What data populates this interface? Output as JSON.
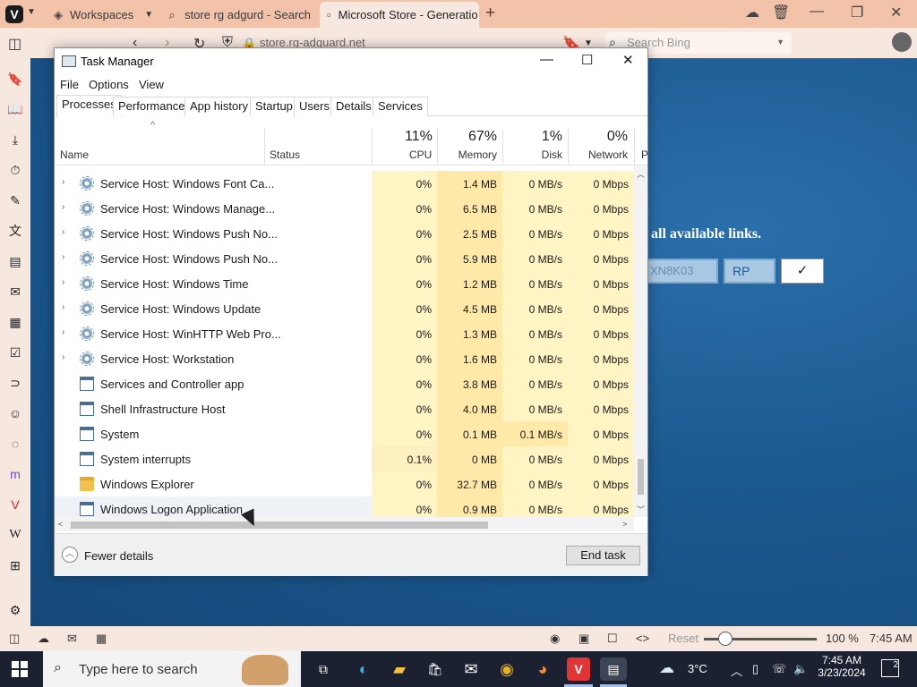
{
  "browser": {
    "workspaces_label": "Workspaces",
    "tabs": [
      {
        "label": "store rg adgurd - Search",
        "icon": "search-icon"
      },
      {
        "label": "Microsoft Store - Generatio",
        "icon": "store-favicon"
      }
    ],
    "url": "store.rg-adguard.net",
    "search_placeholder": "Search Bing",
    "status": {
      "reset_label": "Reset",
      "zoom": "100 %",
      "time": "7:45 AM"
    }
  },
  "webpage": {
    "links_text": "all available links.",
    "input_value": "XN8K03",
    "select_value": "RP",
    "submit_label": "✓"
  },
  "task_manager": {
    "title": "Task Manager",
    "menu": [
      "File",
      "Options",
      "View"
    ],
    "tabs": [
      "Processes",
      "Performance",
      "App history",
      "Startup",
      "Users",
      "Details",
      "Services"
    ],
    "active_tab": "Processes",
    "columns": {
      "name": "Name",
      "status": "Status",
      "cpu": {
        "pct": "11%",
        "label": "CPU"
      },
      "memory": {
        "pct": "67%",
        "label": "Memory"
      },
      "disk": {
        "pct": "1%",
        "label": "Disk"
      },
      "network": {
        "pct": "0%",
        "label": "Network"
      },
      "cut": "P"
    },
    "rows": [
      {
        "name": "Service Host: Windows Font Ca...",
        "icon": "gear-icon",
        "expandable": true,
        "cpu": "0%",
        "memory": "1.4 MB",
        "disk": "0 MB/s",
        "network": "0 Mbps"
      },
      {
        "name": "Service Host: Windows Manage...",
        "icon": "gear-icon",
        "expandable": true,
        "cpu": "0%",
        "memory": "6.5 MB",
        "disk": "0 MB/s",
        "network": "0 Mbps"
      },
      {
        "name": "Service Host: Windows Push No...",
        "icon": "gear-icon",
        "expandable": true,
        "cpu": "0%",
        "memory": "2.5 MB",
        "disk": "0 MB/s",
        "network": "0 Mbps"
      },
      {
        "name": "Service Host: Windows Push No...",
        "icon": "gear-icon",
        "expandable": true,
        "cpu": "0%",
        "memory": "5.9 MB",
        "disk": "0 MB/s",
        "network": "0 Mbps"
      },
      {
        "name": "Service Host: Windows Time",
        "icon": "gear-icon",
        "expandable": true,
        "cpu": "0%",
        "memory": "1.2 MB",
        "disk": "0 MB/s",
        "network": "0 Mbps"
      },
      {
        "name": "Service Host: Windows Update",
        "icon": "gear-icon",
        "expandable": true,
        "cpu": "0%",
        "memory": "4.5 MB",
        "disk": "0 MB/s",
        "network": "0 Mbps"
      },
      {
        "name": "Service Host: WinHTTP Web Pro...",
        "icon": "gear-icon",
        "expandable": true,
        "cpu": "0%",
        "memory": "1.3 MB",
        "disk": "0 MB/s",
        "network": "0 Mbps"
      },
      {
        "name": "Service Host: Workstation",
        "icon": "gear-icon",
        "expandable": true,
        "cpu": "0%",
        "memory": "1.6 MB",
        "disk": "0 MB/s",
        "network": "0 Mbps"
      },
      {
        "name": "Services and Controller app",
        "icon": "window-icon",
        "expandable": false,
        "cpu": "0%",
        "memory": "3.8 MB",
        "disk": "0 MB/s",
        "network": "0 Mbps"
      },
      {
        "name": "Shell Infrastructure Host",
        "icon": "window-icon",
        "expandable": false,
        "cpu": "0%",
        "memory": "4.0 MB",
        "disk": "0 MB/s",
        "network": "0 Mbps"
      },
      {
        "name": "System",
        "icon": "window-icon",
        "expandable": false,
        "cpu": "0%",
        "memory": "0.1 MB",
        "disk": "0.1 MB/s",
        "network": "0 Mbps"
      },
      {
        "name": "System interrupts",
        "icon": "window-icon",
        "expandable": false,
        "cpu": "0.1%",
        "memory": "0 MB",
        "disk": "0 MB/s",
        "network": "0 Mbps"
      },
      {
        "name": "Windows Explorer",
        "icon": "folder-icon",
        "expandable": false,
        "cpu": "0%",
        "memory": "32.7 MB",
        "disk": "0 MB/s",
        "network": "0 Mbps"
      },
      {
        "name": "Windows Logon Application",
        "icon": "window-icon",
        "expandable": false,
        "cpu": "0%",
        "memory": "0.9 MB",
        "disk": "0 MB/s",
        "network": "0 Mbps"
      }
    ],
    "fewer_details": "Fewer details",
    "end_task": "End task"
  },
  "taskbar": {
    "search_text": "Type here to search",
    "weather": "3°C",
    "time": "7:45 AM",
    "date": "3/23/2024",
    "notifications": "2"
  }
}
